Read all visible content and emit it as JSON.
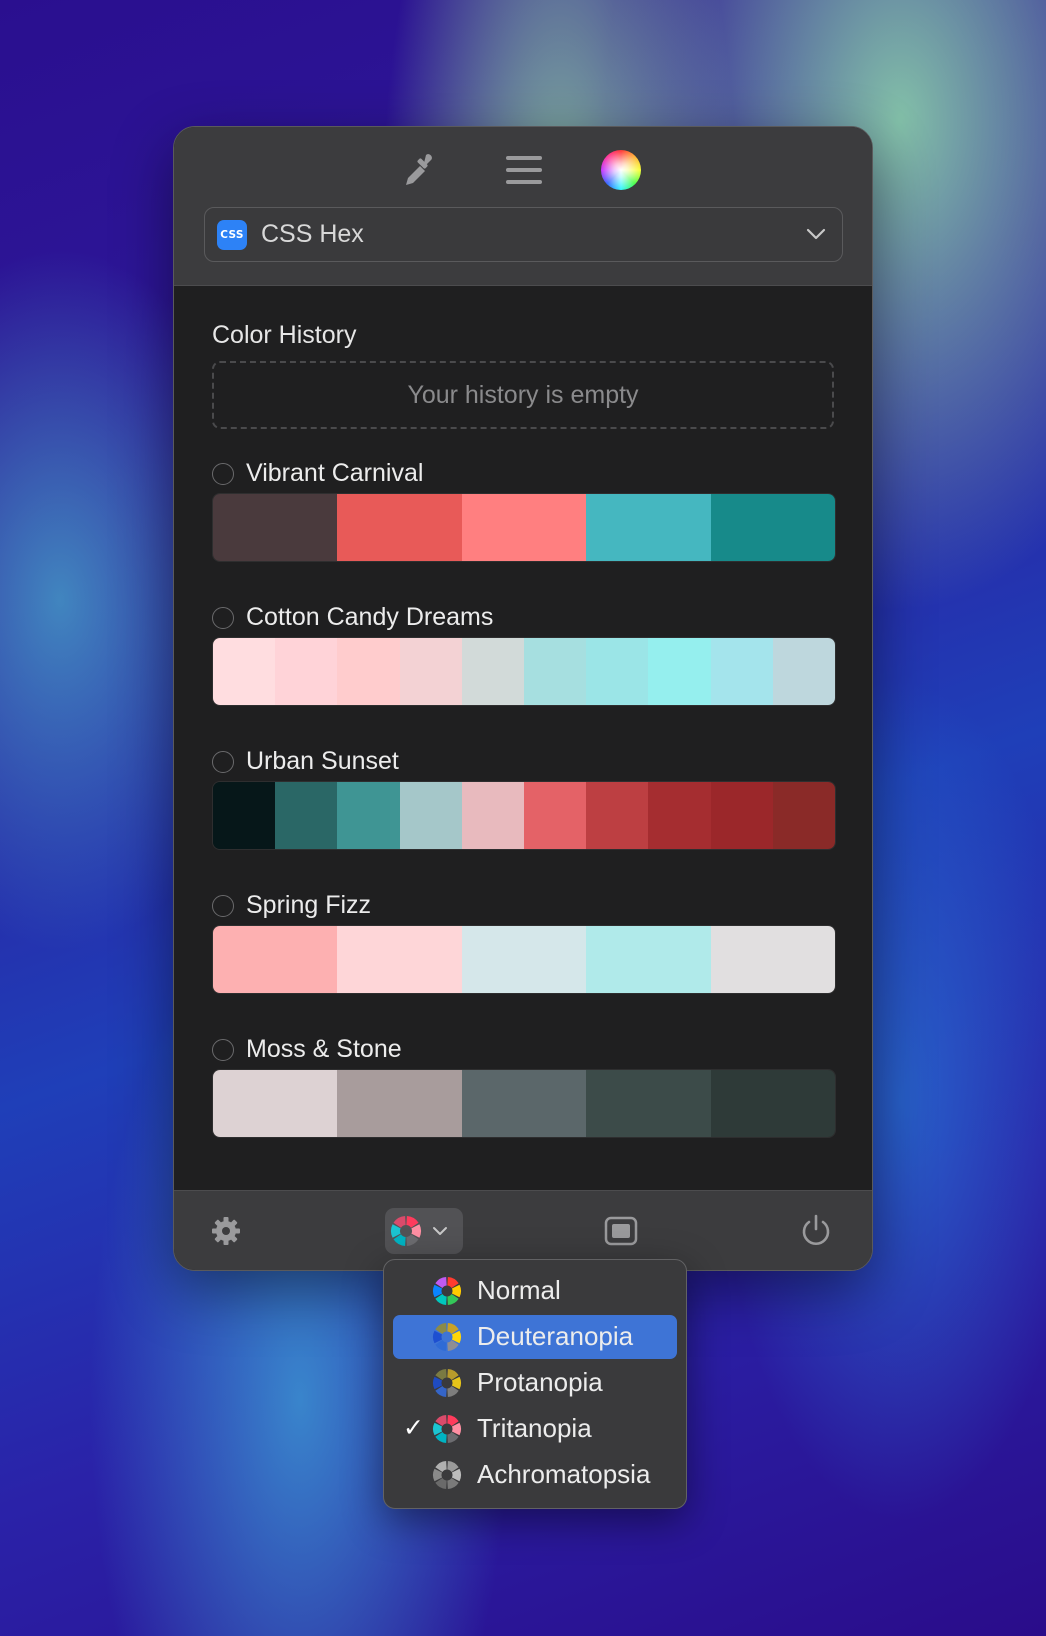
{
  "toolbar": {
    "format_icon": "eyedropper-icon",
    "menu_icon": "hamburger-icon",
    "color_icon": "color-wheel-icon",
    "format_badge": "CSS",
    "format_label": "CSS Hex"
  },
  "history": {
    "title": "Color History",
    "empty_text": "Your history is empty"
  },
  "palettes": [
    {
      "name": "Vibrant Carnival",
      "colors": [
        "#4a3a3d",
        "#e85a58",
        "#ff7f80",
        "#45b7c0",
        "#178a8a"
      ]
    },
    {
      "name": "Cotton Candy Dreams",
      "colors": [
        "#ffdde0",
        "#ffd3d8",
        "#ffcccd",
        "#f3d2d4",
        "#d2dad9",
        "#a6dfe0",
        "#9be5e7",
        "#95efee",
        "#a4e4ec",
        "#bed7dd"
      ]
    },
    {
      "name": "Urban Sunset",
      "colors": [
        "#061719",
        "#2a6766",
        "#3f9594",
        "#a5c7c9",
        "#e8babe",
        "#e46267",
        "#bd3f42",
        "#a52d30",
        "#9b272a",
        "#8a2a28"
      ]
    },
    {
      "name": "Spring Fizz",
      "colors": [
        "#fdb0b1",
        "#fed6d8",
        "#d5e7ea",
        "#b0eaea",
        "#e1dfe0"
      ]
    },
    {
      "name": "Moss & Stone",
      "colors": [
        "#ddd2d3",
        "#a89c9c",
        "#5b676a",
        "#3c4b49",
        "#2e3a38"
      ]
    }
  ],
  "bottom": {
    "settings_icon": "gear-icon",
    "vision_icon": "vision-wheel-icon",
    "vision_chevron": "chevron-down-icon",
    "window_icon": "window-icon",
    "power_icon": "power-icon"
  },
  "vision_menu": {
    "items": [
      {
        "label": "Normal",
        "checked": false,
        "highlighted": false
      },
      {
        "label": "Deuteranopia",
        "checked": false,
        "highlighted": true
      },
      {
        "label": "Protanopia",
        "checked": false,
        "highlighted": false
      },
      {
        "label": "Tritanopia",
        "checked": true,
        "highlighted": false
      },
      {
        "label": "Achromatopsia",
        "checked": false,
        "highlighted": false
      }
    ],
    "check_mark": "✓"
  },
  "colors": {
    "panel_bg": "#1f1f20",
    "bar_bg": "#3c3c3e",
    "accent": "#3e74d6",
    "css_badge": "#2d82f6"
  }
}
